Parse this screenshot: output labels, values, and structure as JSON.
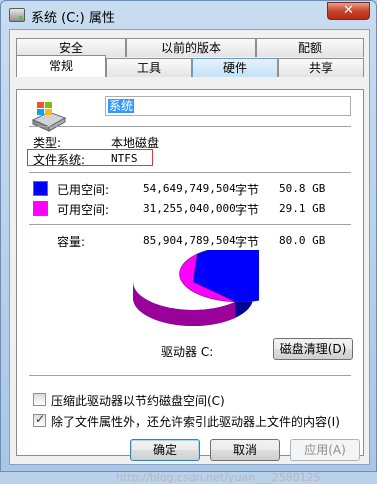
{
  "window": {
    "title": "系统 (C:) 属性",
    "close_glyph": "✕"
  },
  "tabs_top": [
    "安全",
    "以前的版本",
    "配额"
  ],
  "tabs_bottom": [
    "常规",
    "工具",
    "硬件",
    "共享"
  ],
  "general": {
    "name_value": "系统",
    "type_label": "类型:",
    "type_value": "本地磁盘",
    "fs_label": "文件系统:",
    "fs_value": "NTFS",
    "used": {
      "label": "已用空间:",
      "bytes": "54,649,749,504",
      "unit": "字节",
      "size": "50.8 GB",
      "color": "#0000ff"
    },
    "free": {
      "label": "可用空间:",
      "bytes": "31,255,040,000",
      "unit": "字节",
      "size": "29.1 GB",
      "color": "#ff00ff"
    },
    "capacity": {
      "label": "容量:",
      "bytes": "85,904,789,504",
      "unit": "字节",
      "size": "80.0 GB"
    },
    "used_fraction": 0.636,
    "drive_label": "驱动器 C:",
    "cleanup_button": "磁盘清理(D)",
    "compress_label": "压缩此驱动器以节约磁盘空间(C)",
    "compress_checked": false,
    "index_label": "除了文件属性外，还允许索引此驱动器上文件的内容(I)",
    "index_checked": true
  },
  "footer": {
    "ok": "确定",
    "cancel": "取消",
    "apply": "应用(A)"
  },
  "watermark": "http://blog.csdn.net/yuan___2580125"
}
